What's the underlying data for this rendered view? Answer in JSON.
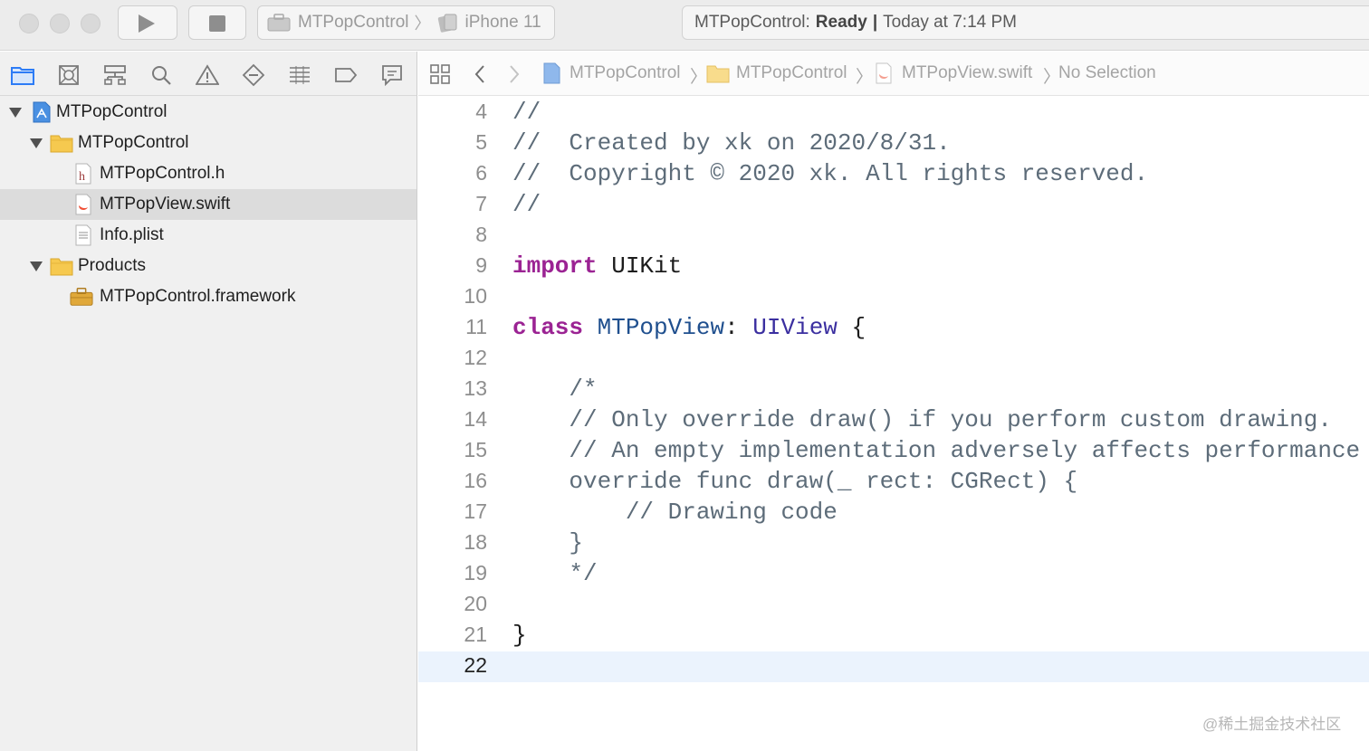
{
  "toolbar": {
    "scheme": {
      "target": "MTPopControl",
      "device": "iPhone 11"
    },
    "status": {
      "project": "MTPopControl:",
      "state": "Ready",
      "divider": "|",
      "time": "Today at 7:14 PM"
    }
  },
  "navigator": {
    "tabs": [
      "project-navigator-icon",
      "source-control-icon",
      "symbol-navigator-icon",
      "find-icon",
      "issue-icon",
      "test-icon",
      "debug-icon",
      "breakpoint-icon",
      "report-icon"
    ],
    "tree": [
      {
        "label": "MTPopControl",
        "kind": "project"
      },
      {
        "label": "MTPopControl",
        "kind": "folder"
      },
      {
        "label": "MTPopControl.h",
        "kind": "header-file"
      },
      {
        "label": "MTPopView.swift",
        "kind": "swift-file",
        "selected": true
      },
      {
        "label": "Info.plist",
        "kind": "plist-file"
      },
      {
        "label": "Products",
        "kind": "folder"
      },
      {
        "label": "MTPopControl.framework",
        "kind": "framework"
      }
    ]
  },
  "jumpbar": {
    "items": [
      "MTPopControl",
      "MTPopControl",
      "MTPopView.swift",
      "No Selection"
    ]
  },
  "editor": {
    "lines": [
      {
        "n": "4",
        "text": "//"
      },
      {
        "n": "5",
        "text": "//  Created by xk on 2020/8/31."
      },
      {
        "n": "6",
        "text": "//  Copyright © 2020 xk. All rights reserved."
      },
      {
        "n": "7",
        "text": "//"
      },
      {
        "n": "8",
        "text": ""
      },
      {
        "n": "9",
        "kw": "import",
        "rest": " UIKit"
      },
      {
        "n": "10",
        "text": ""
      },
      {
        "n": "11",
        "kw": "class",
        "name": "MTPopView",
        "colon": ": ",
        "super": "UIView",
        "brace": " {"
      },
      {
        "n": "12",
        "text": ""
      },
      {
        "n": "13",
        "text": "    /*"
      },
      {
        "n": "14",
        "text": "    // Only override draw() if you perform custom drawing."
      },
      {
        "n": "15",
        "text": "    // An empty implementation adversely affects performance"
      },
      {
        "n": "16",
        "text": "    override func draw(_ rect: CGRect) {"
      },
      {
        "n": "17",
        "text": "        // Drawing code"
      },
      {
        "n": "18",
        "text": "    }"
      },
      {
        "n": "19",
        "text": "    */"
      },
      {
        "n": "20",
        "text": ""
      },
      {
        "n": "21",
        "text": "}"
      },
      {
        "n": "22",
        "text": ""
      }
    ]
  },
  "watermark": "@稀土掘金技术社区",
  "colors": {
    "keyword": "#9b2393",
    "type": "#1f4f8e",
    "comment": "#5d6c79",
    "current_line": "#ebf3fd",
    "selection": "#dcdcdc"
  }
}
